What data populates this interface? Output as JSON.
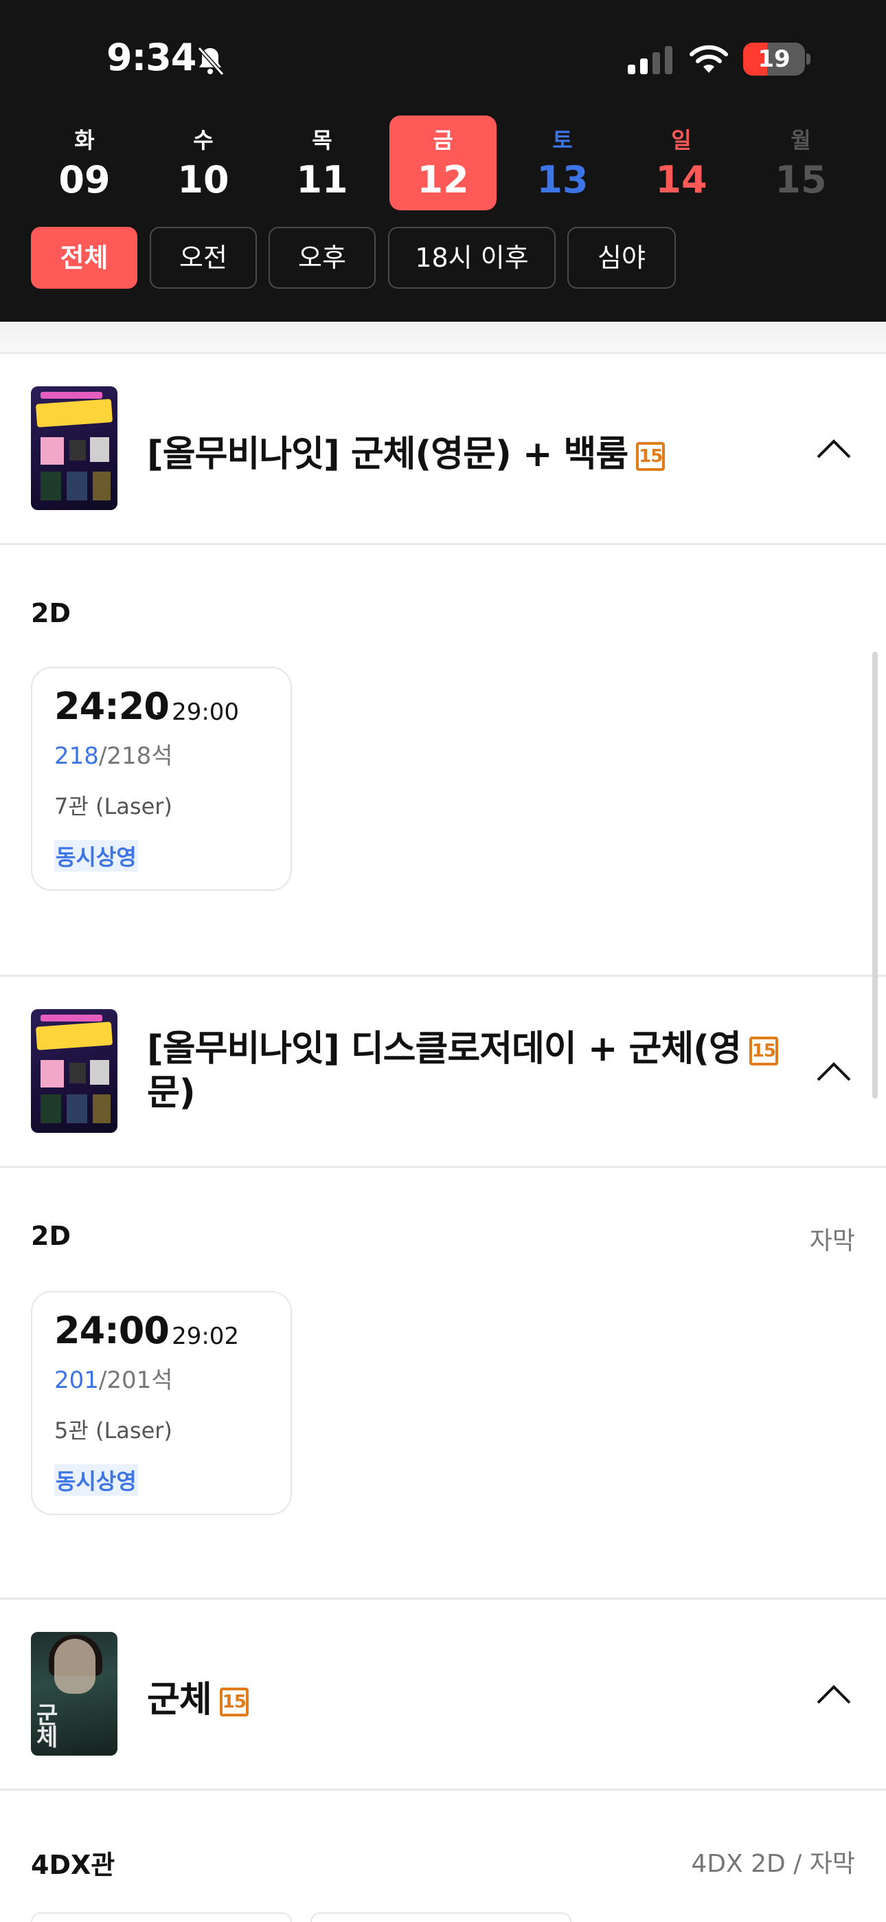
{
  "status_bar": {
    "time": "9:34",
    "battery": "19",
    "battery_level": 0.19
  },
  "dates": [
    {
      "dow": "화",
      "num": "09"
    },
    {
      "dow": "수",
      "num": "10"
    },
    {
      "dow": "목",
      "num": "11"
    },
    {
      "dow": "금",
      "num": "12"
    },
    {
      "dow": "토",
      "num": "13"
    },
    {
      "dow": "일",
      "num": "14"
    },
    {
      "dow": "월",
      "num": "15"
    }
  ],
  "filters": [
    "전체",
    "오전",
    "오후",
    "18시 이후",
    "심야"
  ],
  "movies": [
    {
      "poster_icon": "poster-allmovie-night",
      "title": "[올무비나잇] 군체(영문) + 백룸",
      "rating": "15",
      "format": "2D",
      "format_sub": "",
      "showtime": {
        "start": "24:20",
        "end": "- 29:00",
        "available": "218",
        "total": "/218석",
        "hall": "7관 (Laser)",
        "tag": "동시상영"
      }
    },
    {
      "poster_icon": "poster-allmovie-night",
      "title_line1": "[올무비나잇] 디스클로저데이 + 군체(영",
      "title_line2": "문)",
      "rating": "15",
      "format": "2D",
      "format_sub": "자막",
      "showtime": {
        "start": "24:00",
        "end": "- 29:02",
        "available": "201",
        "total": "/201석",
        "hall": "5관 (Laser)",
        "tag": "동시상영"
      }
    },
    {
      "poster_icon": "poster-gunche",
      "poster_text": "군체",
      "title": "군체",
      "rating": "15",
      "format": "4DX관",
      "format_sub": "4DX 2D / 자막"
    }
  ]
}
